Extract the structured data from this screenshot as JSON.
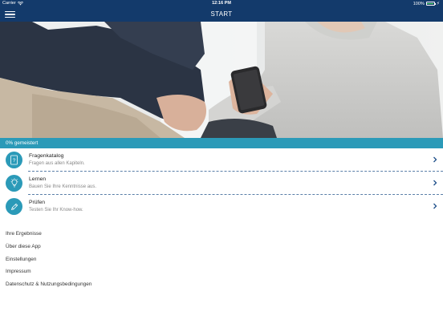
{
  "status_bar": {
    "carrier": "Carrier",
    "time": "12:16 PM",
    "battery": "100%"
  },
  "nav": {
    "title": "START",
    "menu_icon": "hamburger-menu-icon"
  },
  "hero": {
    "description_icon": "hero-photo"
  },
  "progress": {
    "label": "0% gemeistert",
    "value": 0
  },
  "menu_items": [
    {
      "title": "Fragenkatalog",
      "subtitle": "Fragen aus allen Kapiteln.",
      "icon": "question-book-icon"
    },
    {
      "title": "Lernen",
      "subtitle": "Bauen Sie Ihre Kenntnisse aus.",
      "icon": "lightbulb-icon"
    },
    {
      "title": "Prüfen",
      "subtitle": "Testen Sie Ihr Know-how.",
      "icon": "pencil-icon"
    }
  ],
  "links": [
    "Ihre Ergebnisse",
    "Über diese App",
    "Einstellungen",
    "Impressum",
    "Datenschutz & Nutzungsbedingungen"
  ],
  "colors": {
    "nav_bg": "#133a6b",
    "accent": "#2b9ab8",
    "chevron": "#1f4f8a"
  }
}
